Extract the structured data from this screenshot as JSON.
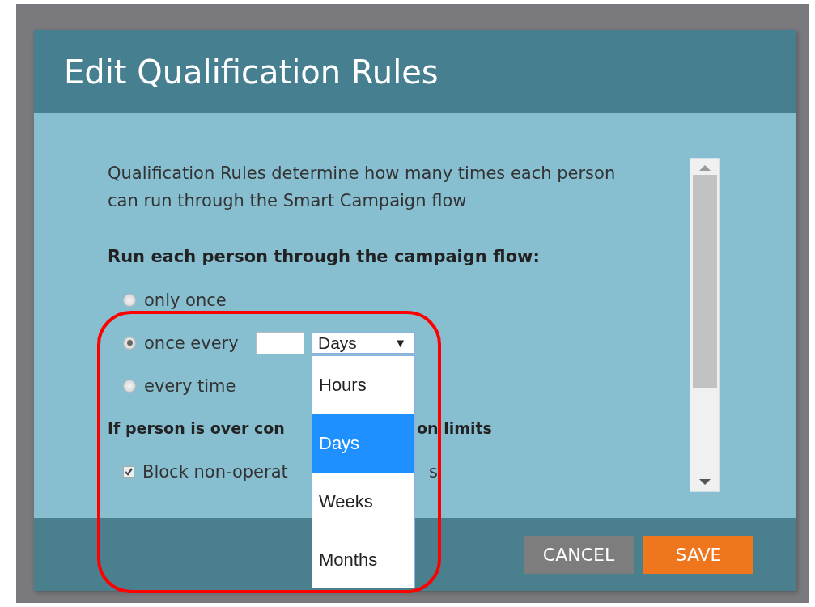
{
  "dialog": {
    "title": "Edit Qualification Rules"
  },
  "description": "Qualification Rules determine how many times each person can run through the Smart Campaign flow",
  "run_heading": "Run each person through the campaign flow:",
  "run_options": [
    {
      "label": "only once",
      "selected": false,
      "kind": "plain"
    },
    {
      "label": "once every",
      "selected": true,
      "kind": "interval"
    },
    {
      "label": "every time",
      "selected": false,
      "kind": "plain"
    }
  ],
  "unit_select": {
    "value": "Days",
    "arrow": "▼",
    "expanded": true,
    "options": [
      {
        "label": "Hours",
        "selected": false
      },
      {
        "label": "Days",
        "selected": true
      },
      {
        "label": "Weeks",
        "selected": false
      },
      {
        "label": "Months",
        "selected": false
      }
    ]
  },
  "limits_heading": [
    "If person is over con",
    "on limits"
  ],
  "block_option": {
    "label_parts": [
      "Block non-operat",
      "s"
    ],
    "checked": true
  },
  "buttons": [
    {
      "label": "CANCEL",
      "kind": "secondary"
    },
    {
      "label": "SAVE",
      "kind": "primary"
    }
  ]
}
